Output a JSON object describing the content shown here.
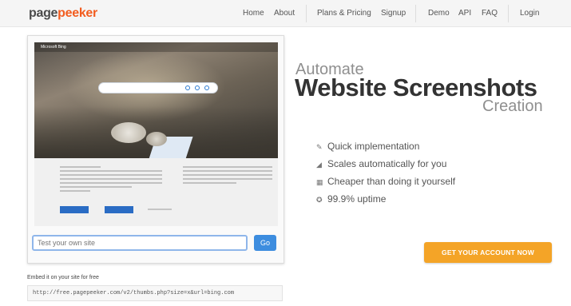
{
  "brand": {
    "logo_part1": "page",
    "logo_part2": "peeker",
    "accent_color": "#f25c1f"
  },
  "nav": {
    "items": [
      {
        "id": "home",
        "label": "Home"
      },
      {
        "id": "about",
        "label": "About"
      },
      {
        "id": "pricing",
        "label": "Plans & Pricing"
      },
      {
        "id": "signup",
        "label": "Signup"
      },
      {
        "id": "demo",
        "label": "Demo"
      },
      {
        "id": "api",
        "label": "API"
      },
      {
        "id": "faq",
        "label": "FAQ"
      },
      {
        "id": "login",
        "label": "Login"
      }
    ]
  },
  "preview": {
    "site_logo": "Microsoft Bing"
  },
  "test": {
    "placeholder": "Test your own site",
    "go_label": "Go"
  },
  "embed": {
    "label": "Embed it on your site for free",
    "code": "http://free.pagepeeker.com/v2/thumbs.php?size=x&url=bing.com"
  },
  "hero": {
    "pre": "Automate",
    "main": "Website Screenshots",
    "post": "Creation"
  },
  "features": [
    {
      "icon": "pencil-icon",
      "glyph": "✎",
      "label": "Quick implementation"
    },
    {
      "icon": "chart-icon",
      "glyph": "◢",
      "label": "Scales automatically for you"
    },
    {
      "icon": "grid-icon",
      "glyph": "▦",
      "label": "Cheaper than doing it yourself"
    },
    {
      "icon": "gauge-icon",
      "glyph": "✪",
      "label": "99.9% uptime"
    }
  ],
  "cta": {
    "label": "GET YOUR ACCOUNT NOW",
    "color": "#f4a427"
  }
}
